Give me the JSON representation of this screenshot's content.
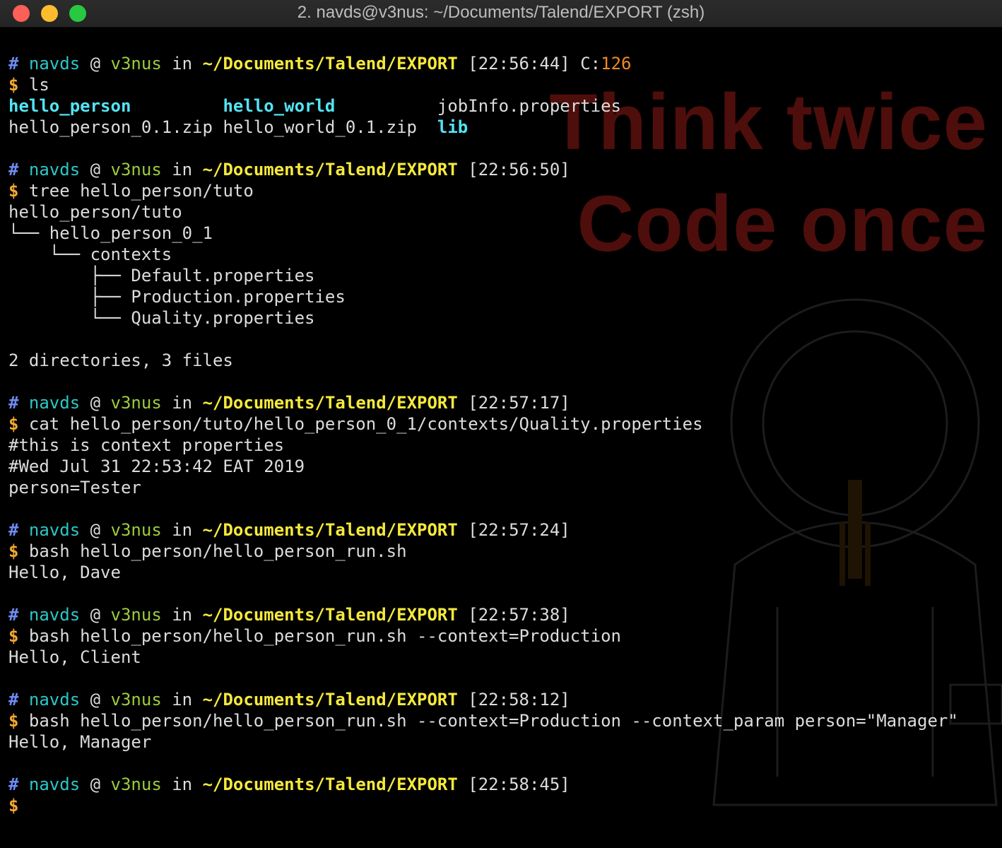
{
  "window": {
    "title": "2. navds@v3nus: ~/Documents/Talend/EXPORT (zsh)"
  },
  "wallpaper": {
    "line1": "Think twice",
    "line2": "Code once"
  },
  "prompt": {
    "hash": "#",
    "user": "navds",
    "at": "@",
    "host": "v3nus",
    "in": "in",
    "path": "~/Documents/Talend/EXPORT",
    "dollar": "$"
  },
  "blocks": [
    {
      "time": "[22:56:44]",
      "exit_label": "C:",
      "exit_code": "126",
      "command": "ls",
      "ls": [
        {
          "name": "hello_person",
          "dir": true
        },
        {
          "name": "hello_world",
          "dir": true
        },
        {
          "name": "jobInfo.properties",
          "dir": false
        },
        {
          "name": "hello_person_0.1.zip",
          "dir": false
        },
        {
          "name": "hello_world_0.1.zip",
          "dir": false
        },
        {
          "name": "lib",
          "dir": true
        }
      ]
    },
    {
      "time": "[22:56:50]",
      "command": "tree hello_person/tuto",
      "output": [
        "hello_person/tuto",
        "└── hello_person_0_1",
        "    └── contexts",
        "        ├── Default.properties",
        "        ├── Production.properties",
        "        └── Quality.properties",
        "",
        "2 directories, 3 files"
      ]
    },
    {
      "time": "[22:57:17]",
      "command": "cat hello_person/tuto/hello_person_0_1/contexts/Quality.properties",
      "output": [
        "#this is context properties",
        "#Wed Jul 31 22:53:42 EAT 2019",
        "person=Tester"
      ]
    },
    {
      "time": "[22:57:24]",
      "command": "bash hello_person/hello_person_run.sh",
      "output": [
        "Hello, Dave"
      ]
    },
    {
      "time": "[22:57:38]",
      "command": "bash hello_person/hello_person_run.sh --context=Production",
      "output": [
        "Hello, Client"
      ]
    },
    {
      "time": "[22:58:12]",
      "command": "bash hello_person/hello_person_run.sh --context=Production --context_param person=\"Manager\"",
      "output": [
        "Hello, Manager"
      ]
    },
    {
      "time": "[22:58:45]",
      "command": "",
      "output": []
    }
  ]
}
